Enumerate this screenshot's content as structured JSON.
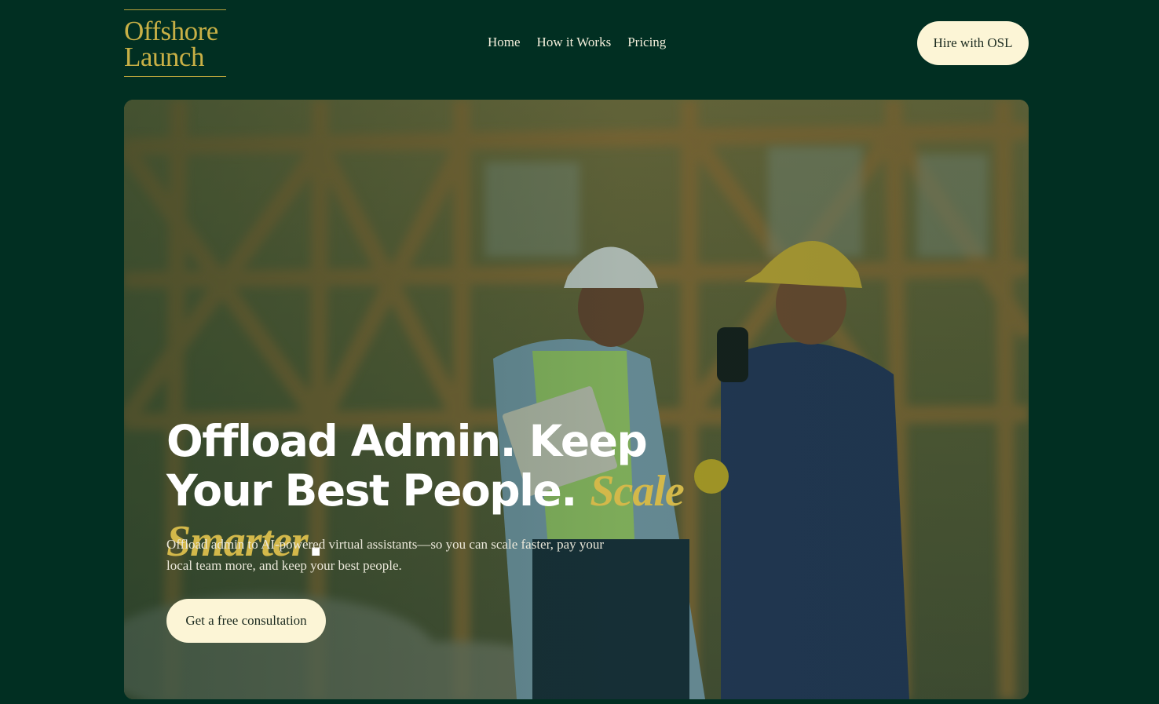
{
  "header": {
    "logo_line1": "Offshore",
    "logo_line2": "Launch",
    "nav": [
      {
        "label": "Home"
      },
      {
        "label": "How it Works"
      },
      {
        "label": "Pricing"
      }
    ],
    "cta_label": "Hire with OSL"
  },
  "hero": {
    "headline_main": "Offload Admin. Keep Your Best People. ",
    "headline_accent": "Scale Smarter",
    "headline_end": ".",
    "subtext": "Offload admin to AI-powered virtual assistants—so you can scale faster, pay your local team more, and keep your best people.",
    "cta_label": "Get a free consultation",
    "image_icon": "construction-workers-photo"
  },
  "colors": {
    "background": "#012f22",
    "accent_gold": "#d3b84a",
    "button_cream": "#fcf5d6",
    "text_light": "#f3eedb"
  }
}
